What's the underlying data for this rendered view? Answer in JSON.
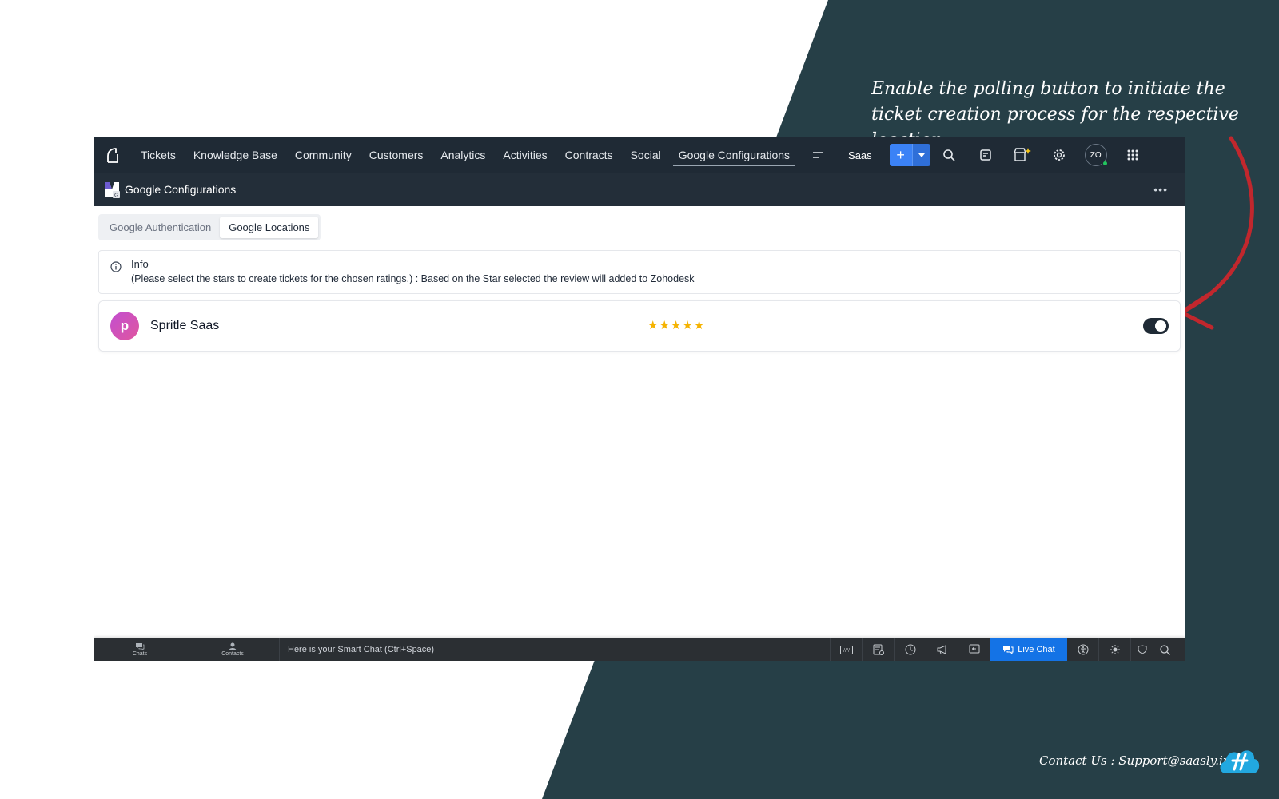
{
  "annotation": {
    "text": "Enable the polling button to initiate the ticket creation process for the respective location"
  },
  "contact": {
    "text": "Contact Us : Support@saasly.in"
  },
  "colors": {
    "background_dark": "#263f47",
    "nav_bg": "#1f2a35",
    "arrow": "#c1272d",
    "accent_blue": "#3b82f6",
    "live_chat": "#1473e6",
    "star": "#f5b301"
  },
  "topnav": {
    "tabs": [
      {
        "label": "Tickets"
      },
      {
        "label": "Knowledge Base"
      },
      {
        "label": "Community"
      },
      {
        "label": "Customers"
      },
      {
        "label": "Analytics"
      },
      {
        "label": "Activities"
      },
      {
        "label": "Contracts"
      },
      {
        "label": "Social"
      },
      {
        "label": "Google Configurations",
        "active": true
      }
    ],
    "org_name": "Saas",
    "add_label": "+",
    "avatar_initials": "ZO"
  },
  "subbar": {
    "title": "Google Configurations",
    "more_label": "•••"
  },
  "subtabs": [
    {
      "label": "Google Authentication",
      "active": false
    },
    {
      "label": "Google Locations",
      "active": true
    }
  ],
  "info": {
    "title": "Info",
    "text": "(Please select the stars to create tickets for the chosen ratings.) : Based on the Star selected the review will added to Zohodesk"
  },
  "location": {
    "avatar_letter": "p",
    "name": "Spritle Saas",
    "stars": 5,
    "polling_enabled": true
  },
  "bottombar": {
    "chats_label": "Chats",
    "contacts_label": "Contacts",
    "smart_chat_placeholder": "Here is your Smart Chat (Ctrl+Space)",
    "live_chat_label": "Live Chat"
  }
}
